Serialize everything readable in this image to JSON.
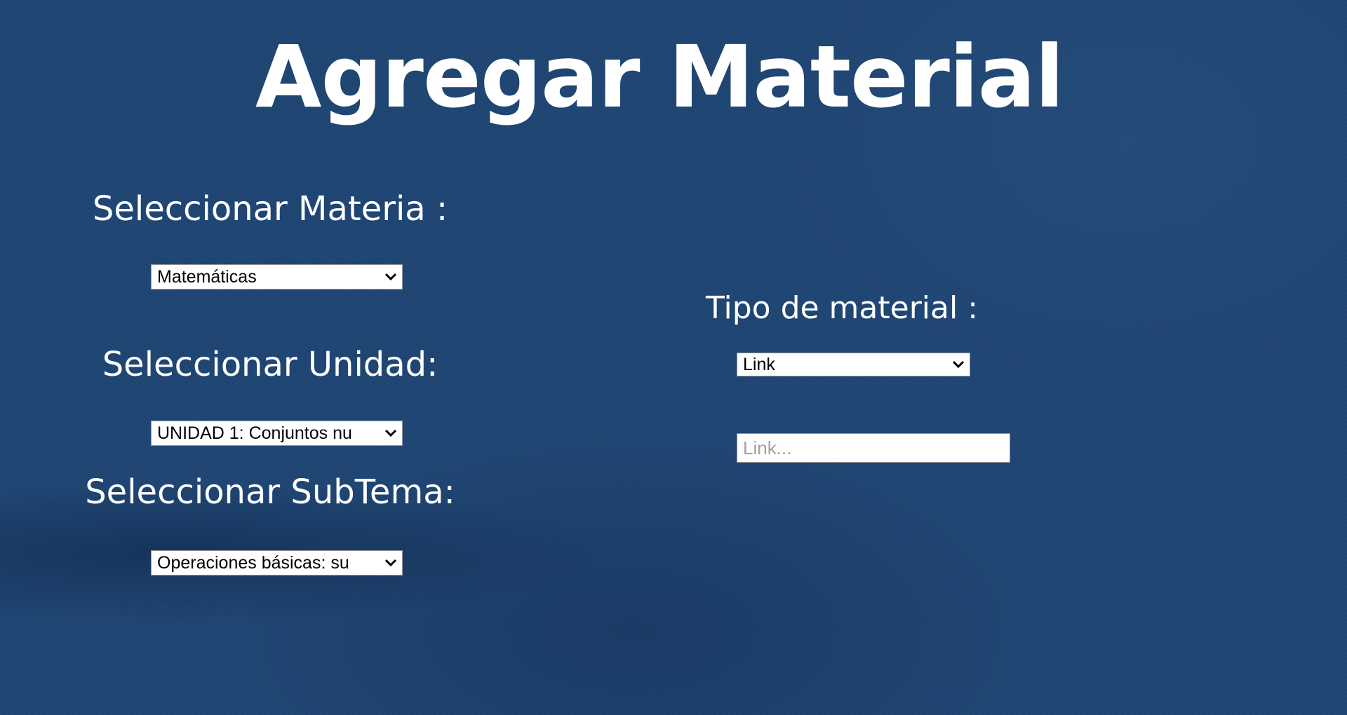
{
  "page": {
    "title": "Agregar Material"
  },
  "form": {
    "materia": {
      "label": "Seleccionar Materia :",
      "selected": "Matemáticas"
    },
    "unidad": {
      "label": "Seleccionar Unidad:",
      "selected": "UNIDAD 1: Conjuntos nu"
    },
    "subtema": {
      "label": "Seleccionar SubTema:",
      "selected": "Operaciones básicas: su"
    },
    "tipo_material": {
      "label": "Tipo de material :",
      "selected": "Link"
    },
    "link_input": {
      "placeholder": "Link...",
      "value": ""
    }
  },
  "icons": {
    "dropdown": "chevron-down-icon"
  },
  "colors": {
    "background": "#1f4573",
    "text": "#ffffff"
  }
}
